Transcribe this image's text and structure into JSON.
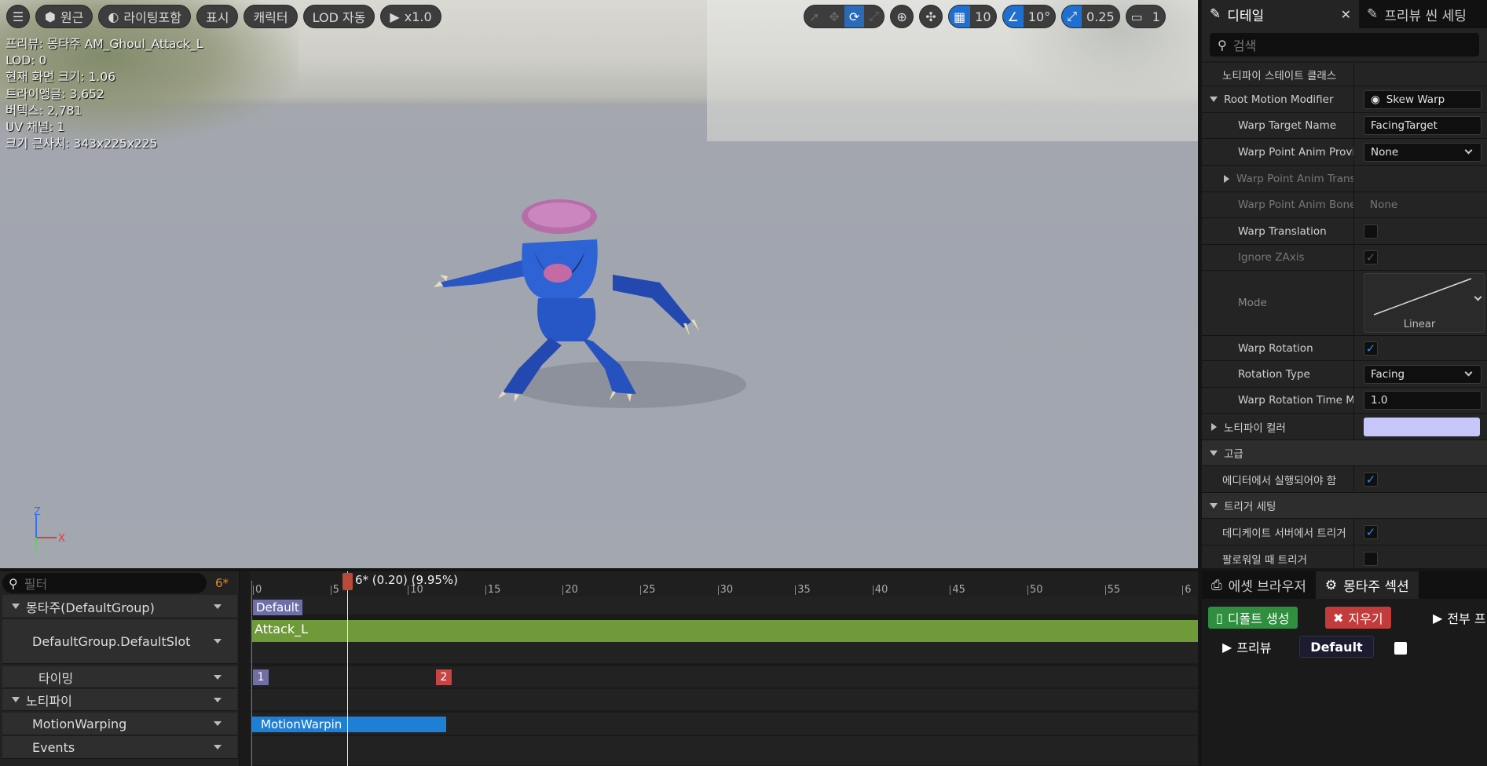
{
  "toolbar": {
    "perspective": "원근",
    "lighting": "라이팅포함",
    "show": "표시",
    "character": "캐릭터",
    "lod": "LOD 자동",
    "playspeed": "x1.0",
    "grid_value": "10",
    "angle_value": "10°",
    "scale_value": "0.25",
    "camera_value": "1"
  },
  "stats": {
    "preview": "프리뷰: 몽타주 AM_Ghoul_Attack_L",
    "lod": "LOD: 0",
    "screen_size": "현재 화면 크기: 1.06",
    "triangles": "트라이앵글: 3,652",
    "vertices": "버텍스: 2,781",
    "uv_channels": "UV 채널: 1",
    "approx_size": "크기 근사치: 343x225x225"
  },
  "axis": {
    "z": "Z",
    "y": "Y",
    "x": "X"
  },
  "details": {
    "tab_details": "디테일",
    "tab_preview_scene": "프리뷰 씬 세팅",
    "search_placeholder": "검색",
    "rows": {
      "notify_state_class": "노티파이 스테이트 클래스",
      "root_motion_modifier": "Root Motion Modifier",
      "root_motion_modifier_value": "Skew Warp",
      "warp_target_name": "Warp Target Name",
      "warp_target_name_value": "FacingTarget",
      "warp_point_anim_provider": "Warp Point Anim Provider",
      "warp_point_anim_provider_value": "None",
      "warp_point_anim_transform": "Warp Point Anim Transf...",
      "warp_point_anim_bone": "Warp Point Anim Bone...",
      "warp_point_anim_bone_value": "None",
      "warp_translation": "Warp Translation",
      "ignore_zaxis": "Ignore ZAxis",
      "mode": "Mode",
      "mode_value": "Linear",
      "warp_rotation": "Warp Rotation",
      "rotation_type": "Rotation Type",
      "rotation_type_value": "Facing",
      "warp_rotation_time_mul": "Warp Rotation Time Mul...",
      "warp_rotation_time_mul_value": "1.0",
      "notify_color": "노티파이 컬러",
      "advanced": "고급",
      "must_run_in_editor": "에디터에서 실행되어야 함",
      "trigger_settings": "트리거 세팅",
      "trigger_on_dedicated_server": "데디케이트 서버에서 트리거",
      "trigger_on_follower": "팔로워일 때 트리거"
    },
    "colors": {
      "notify_color": "#c6c6fb",
      "check": "#2b8cf0"
    }
  },
  "timeline": {
    "filter_placeholder": "필터",
    "filter_count": "6*",
    "playhead_label": "6* (0.20) (9.95%)",
    "tracks": {
      "montage_group": "몽타주(DefaultGroup)",
      "slot": "DefaultGroup.DefaultSlot",
      "timing": "타이밍",
      "notifies": "노티파이",
      "motion_warping": "MotionWarping",
      "events": "Events"
    },
    "ticks": [
      "0",
      "5",
      "10",
      "15",
      "20",
      "25",
      "30",
      "35",
      "40",
      "45",
      "50",
      "55",
      "6"
    ],
    "section_default": "Default",
    "segment_attack": "Attack_L",
    "timing_marker_1": "1",
    "timing_marker_2": "2",
    "notify_state": "MotionWarpin"
  },
  "asset": {
    "tab_asset_browser": "에셋 브라우저",
    "tab_montage_sections": "몽타주 섹션",
    "create_default": "디폴트 생성",
    "clear": "지우기",
    "preview_all": "전부 프",
    "preview": "프리뷰",
    "default_section": "Default"
  }
}
